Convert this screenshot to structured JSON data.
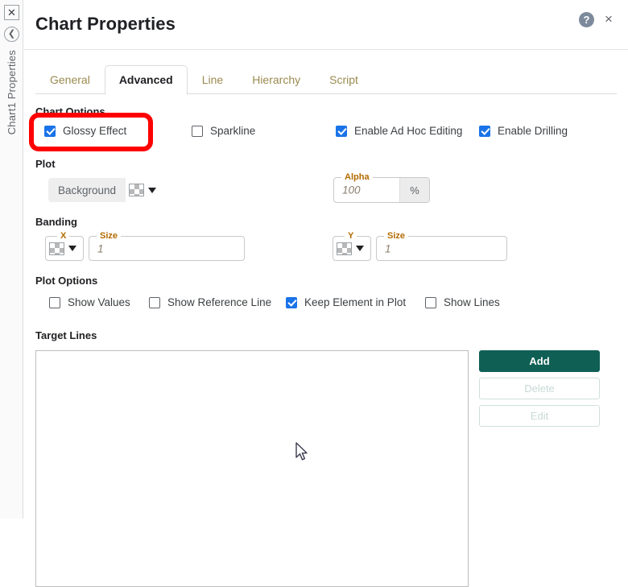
{
  "rail": {
    "close_icon": "close-icon",
    "back_icon": "chevron-left-icon",
    "label": "Chart1 Properties"
  },
  "header": {
    "title": "Chart Properties",
    "help_label": "?",
    "close_label": "×"
  },
  "tabs": [
    {
      "label": "General",
      "active": false
    },
    {
      "label": "Advanced",
      "active": true
    },
    {
      "label": "Line",
      "active": false
    },
    {
      "label": "Hierarchy",
      "active": false
    },
    {
      "label": "Script",
      "active": false
    }
  ],
  "chart_options": {
    "title": "Chart Options",
    "items": [
      {
        "label": "Glossy Effect",
        "checked": true
      },
      {
        "label": "Sparkline",
        "checked": false
      },
      {
        "label": "Enable Ad Hoc Editing",
        "checked": true
      },
      {
        "label": "Enable Drilling",
        "checked": true
      }
    ]
  },
  "plot": {
    "title": "Plot",
    "background_label": "Background",
    "alpha_label": "Alpha",
    "alpha_value": "100",
    "alpha_suffix": "%"
  },
  "banding": {
    "title": "Banding",
    "x_label": "X",
    "x_size_label": "Size",
    "x_size_value": "1",
    "y_label": "Y",
    "y_size_label": "Size",
    "y_size_value": "1"
  },
  "plot_options": {
    "title": "Plot Options",
    "items": [
      {
        "label": "Show Values",
        "checked": false
      },
      {
        "label": "Show Reference Line",
        "checked": false
      },
      {
        "label": "Keep Element in Plot",
        "checked": true
      },
      {
        "label": "Show Lines",
        "checked": false
      }
    ]
  },
  "target_lines": {
    "title": "Target Lines",
    "list_items": [],
    "add_label": "Add",
    "delete_label": "Delete",
    "edit_label": "Edit"
  },
  "annotation": {
    "highlight_target": "Glossy Effect",
    "color": "#ff0000"
  },
  "colors": {
    "accent_checkbox": "#1a73e8",
    "primary_button": "#0f5f55",
    "tab_inactive_text": "#9a8a4f",
    "legend_text": "#b36b00",
    "annotation": "#ff0000"
  }
}
